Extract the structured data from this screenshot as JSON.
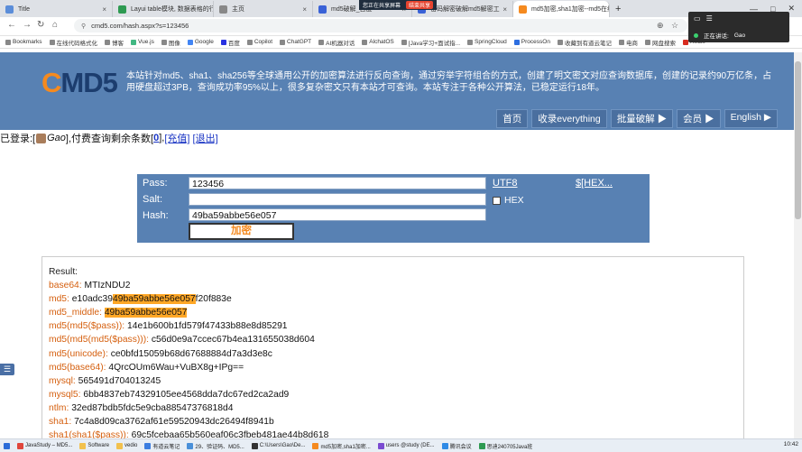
{
  "browser": {
    "tabs": [
      {
        "label": "Title",
        "color": "#5b8dd9"
      },
      {
        "label": "Layui table模块, 数据表格的行",
        "color": "#2e9a52"
      },
      {
        "label": "主页",
        "color": "#888888"
      },
      {
        "label": "md5破解_百度",
        "color": "#3a62d7"
      },
      {
        "label": "密码解密破解md5解密工",
        "color": "#3a62d7"
      },
      {
        "label": "md5加密,sha1加密--md5在线",
        "color": "#f58a1f"
      }
    ],
    "new_tab": "+",
    "share_banner": {
      "text": "您正在共享屏幕",
      "stop": "结束共享"
    },
    "url": "cmd5.com/hash.aspx?s=123456",
    "bookmarks": [
      "Bookmarks",
      "在线代码格式化",
      "博客",
      "Vue.js",
      "图像",
      "Google",
      "百度",
      "Copilot",
      "ChatGPT",
      "AI机器对话",
      "AlchatOS",
      "[Java学习+面试指...",
      "SpringCloud",
      "ProcessOn",
      "收藏到有道云笔记",
      "电商",
      "网盘搜索",
      "Redis"
    ]
  },
  "recording_overlay": {
    "status": "正在讲话:",
    "speaker": "Gao"
  },
  "site": {
    "logo_c": "C",
    "logo_rest": "MD5",
    "intro": "本站针对md5、sha1、sha256等全球通用公开的加密算法进行反向查询，通过穷举字符组合的方式，创建了明文密文对应查询数据库，创建的记录约90万亿条，占用硬盘超过3PB，查询成功率95%以上，很多复杂密文只有本站才可查询。本站专注于各种公开算法，已稳定运行18年。",
    "nav": [
      "首页",
      "收录everything",
      "批量破解 ▶",
      "会员 ▶",
      "English ▶"
    ]
  },
  "login": {
    "prefix": "已登录:[",
    "user": "Gao",
    "mid": "],付费查询剩余条数[",
    "count": "0",
    "close": "],",
    "recharge": "[充值]",
    "logout": "[退出]"
  },
  "form": {
    "pass_label": "Pass:",
    "pass_value": "123456",
    "salt_label": "Salt:",
    "salt_value": "",
    "hash_label": "Hash:",
    "hash_value": "49ba59abbe56e057",
    "encrypt_button": "加密",
    "utf8": "UTF8",
    "hex_link": "$[HEX...",
    "hex_checkbox": "HEX"
  },
  "result": {
    "title": "Result:",
    "lines": [
      {
        "key": "base64",
        "value": "MTIzNDU2"
      },
      {
        "key": "md5",
        "pre": "e10adc39",
        "hl": "49ba59abbe56e057",
        "post": "f20f883e"
      },
      {
        "key": "md5_middle",
        "pre": "",
        "hl": "49ba59abbe56e057",
        "post": ""
      },
      {
        "key": "md5(md5($pass))",
        "value": "14e1b600b1fd579f47433b88e8d85291"
      },
      {
        "key": "md5(md5(md5($pass)))",
        "value": "c56d0e9a7ccec67b4ea131655038d604"
      },
      {
        "key": "md5(unicode)",
        "value": "ce0bfd15059b68d67688884d7a3d3e8c"
      },
      {
        "key": "md5(base64)",
        "value": "4QrcOUm6Wau+VuBX8g+IPg=="
      },
      {
        "key": "mysql",
        "value": "565491d704013245"
      },
      {
        "key": "mysql5",
        "value": "6bb4837eb74329105ee4568dda7dc67ed2ca2ad9"
      },
      {
        "key": "ntlm",
        "value": "32ed87bdb5fdc5e9cba88547376818d4"
      },
      {
        "key": "sha1",
        "value": "7c4a8d09ca3762af61e59520943dc26494f8941b"
      },
      {
        "key": "sha1(sha1($pass))",
        "value": "69c5fcebaa65b560eaf06c3fbeb481ae44b8d618"
      }
    ]
  },
  "taskbar": {
    "items": [
      "JavaStudy – MD5...",
      "Software",
      "vedio",
      "有道云笔记",
      "29、验证码、MD5...",
      "C:\\Users\\Gao\\De...",
      "md5加密,sha1加密...",
      "users @study (DE...",
      "腾讯会议",
      "思迪240705Java班"
    ],
    "time": "10:42"
  }
}
